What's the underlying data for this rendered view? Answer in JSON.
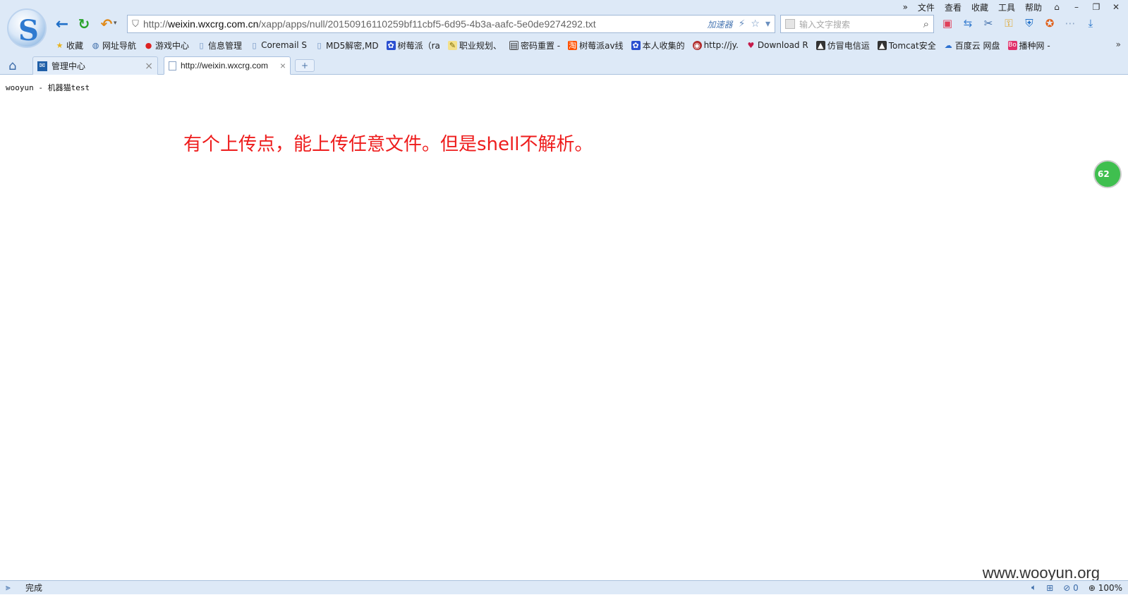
{
  "browser": {
    "menu": [
      "文件",
      "查看",
      "收藏",
      "工具",
      "帮助"
    ],
    "menu_expand": "»",
    "address": {
      "scheme": "http://",
      "host": "weixin.wxcrg.com.cn",
      "path": "/xapp/apps/null/20150916110259bf11cbf5-6d95-4b3a-aafc-5e0de9274292.txt",
      "accelerator_label": "加速器"
    },
    "search_placeholder": "输入文字搜索",
    "bookmarks": [
      {
        "label": "收藏",
        "icon": "star-icon"
      },
      {
        "label": "网址导航",
        "icon": "globe-icon"
      },
      {
        "label": "游戏中心",
        "icon": "game-icon"
      },
      {
        "label": "信息管理",
        "icon": "page-icon"
      },
      {
        "label": "Coremail S",
        "icon": "page-icon"
      },
      {
        "label": "MD5解密,MD",
        "icon": "page-icon"
      },
      {
        "label": "树莓派（ra",
        "icon": "paw-icon"
      },
      {
        "label": "职业规划、",
        "icon": "edit-icon"
      },
      {
        "label": "密码重置 -",
        "icon": "image-icon"
      },
      {
        "label": "树莓派av线",
        "icon": "taobao-icon"
      },
      {
        "label": "本人收集的",
        "icon": "paw-icon"
      },
      {
        "label": "http://jy.",
        "icon": "seal-icon"
      },
      {
        "label": "Download R",
        "icon": "raspberry-icon"
      },
      {
        "label": "仿冒电信运",
        "icon": "image-icon"
      },
      {
        "label": "Tomcat安全",
        "icon": "image-icon"
      },
      {
        "label": "百度云 网盘",
        "icon": "cloud-icon"
      },
      {
        "label": "播种网 -",
        "icon": "bo-icon"
      }
    ],
    "bookmarks_more": "»",
    "tabs": [
      {
        "label": "管理中心",
        "active": false
      },
      {
        "label": "http://weixin.wxcrg.com",
        "active": true
      }
    ],
    "new_tab": "+",
    "status": {
      "text": "完成",
      "counter": "0",
      "zoom": "100%"
    }
  },
  "page": {
    "title_line": "wooyun - 机器猫test",
    "annotation": "有个上传点，能上传任意文件。但是shell不解析。",
    "side_badge": "62"
  },
  "watermark": "www.wooyun.org",
  "colors": {
    "annotation": "#ee1c1c",
    "chrome_bg": "#dde9f7",
    "badge": "#3fbf4f"
  }
}
